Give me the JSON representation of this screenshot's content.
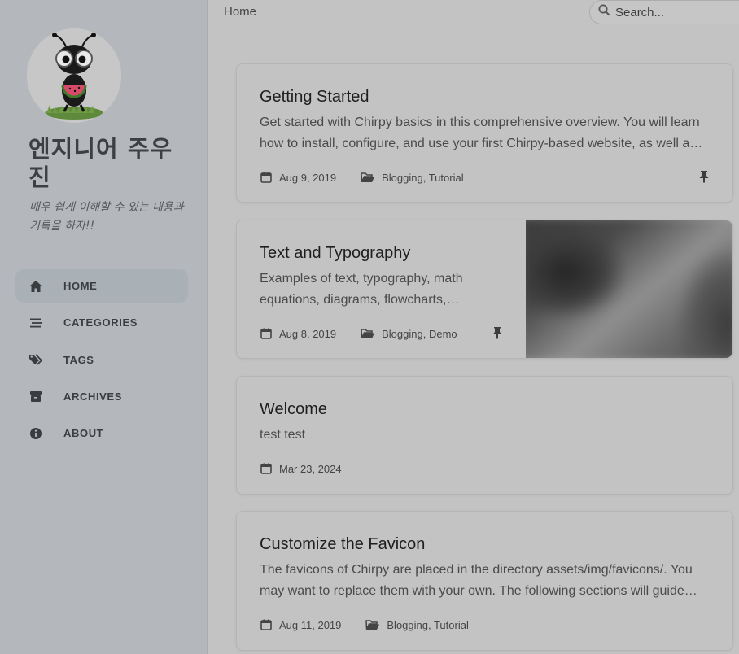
{
  "sidebar": {
    "title": "엔지니어 주우진",
    "subtitle": "매우 쉽게 이해할 수 있는 내용과 기록을 하자!!",
    "nav": [
      {
        "label": "HOME",
        "icon": "home-icon",
        "active": true
      },
      {
        "label": "CATEGORIES",
        "icon": "stream-icon",
        "active": false
      },
      {
        "label": "TAGS",
        "icon": "tags-icon",
        "active": false
      },
      {
        "label": "ARCHIVES",
        "icon": "archive-icon",
        "active": false
      },
      {
        "label": "ABOUT",
        "icon": "info-circle-icon",
        "active": false
      }
    ]
  },
  "topbar": {
    "breadcrumb": "Home",
    "search_placeholder": "Search..."
  },
  "posts": [
    {
      "title": "Getting Started",
      "excerpt": [
        "Get started with Chirpy basics in this comprehensive overview. You will learn",
        "how to install, configure, and use your first Chirpy-based website, as well a…"
      ],
      "date": "Aug 9, 2019",
      "categories": "Blogging, Tutorial",
      "pinned": true
    },
    {
      "title": "Text and Typography",
      "excerpt": [
        "Examples of text, typography, math",
        "equations, diagrams, flowcharts,…"
      ],
      "date": "Aug 8, 2019",
      "categories": "Blogging, Demo",
      "pinned": true
    },
    {
      "title": "Welcome",
      "excerpt": [
        "test test"
      ],
      "date": "Mar 23, 2024",
      "categories": "",
      "pinned": false
    },
    {
      "title": "Customize the Favicon",
      "excerpt": [
        "The favicons of Chirpy are placed in the directory assets/img/favicons/. You",
        "may want to replace them with your own. The following sections will guide…"
      ],
      "date": "Aug 11, 2019",
      "categories": "Blogging, Tutorial",
      "pinned": false
    }
  ],
  "colors": {
    "sidebar_bg": "#b4b8bc",
    "page_bg": "#c3c3c3",
    "active_nav_bg": "#a9b0b6"
  }
}
